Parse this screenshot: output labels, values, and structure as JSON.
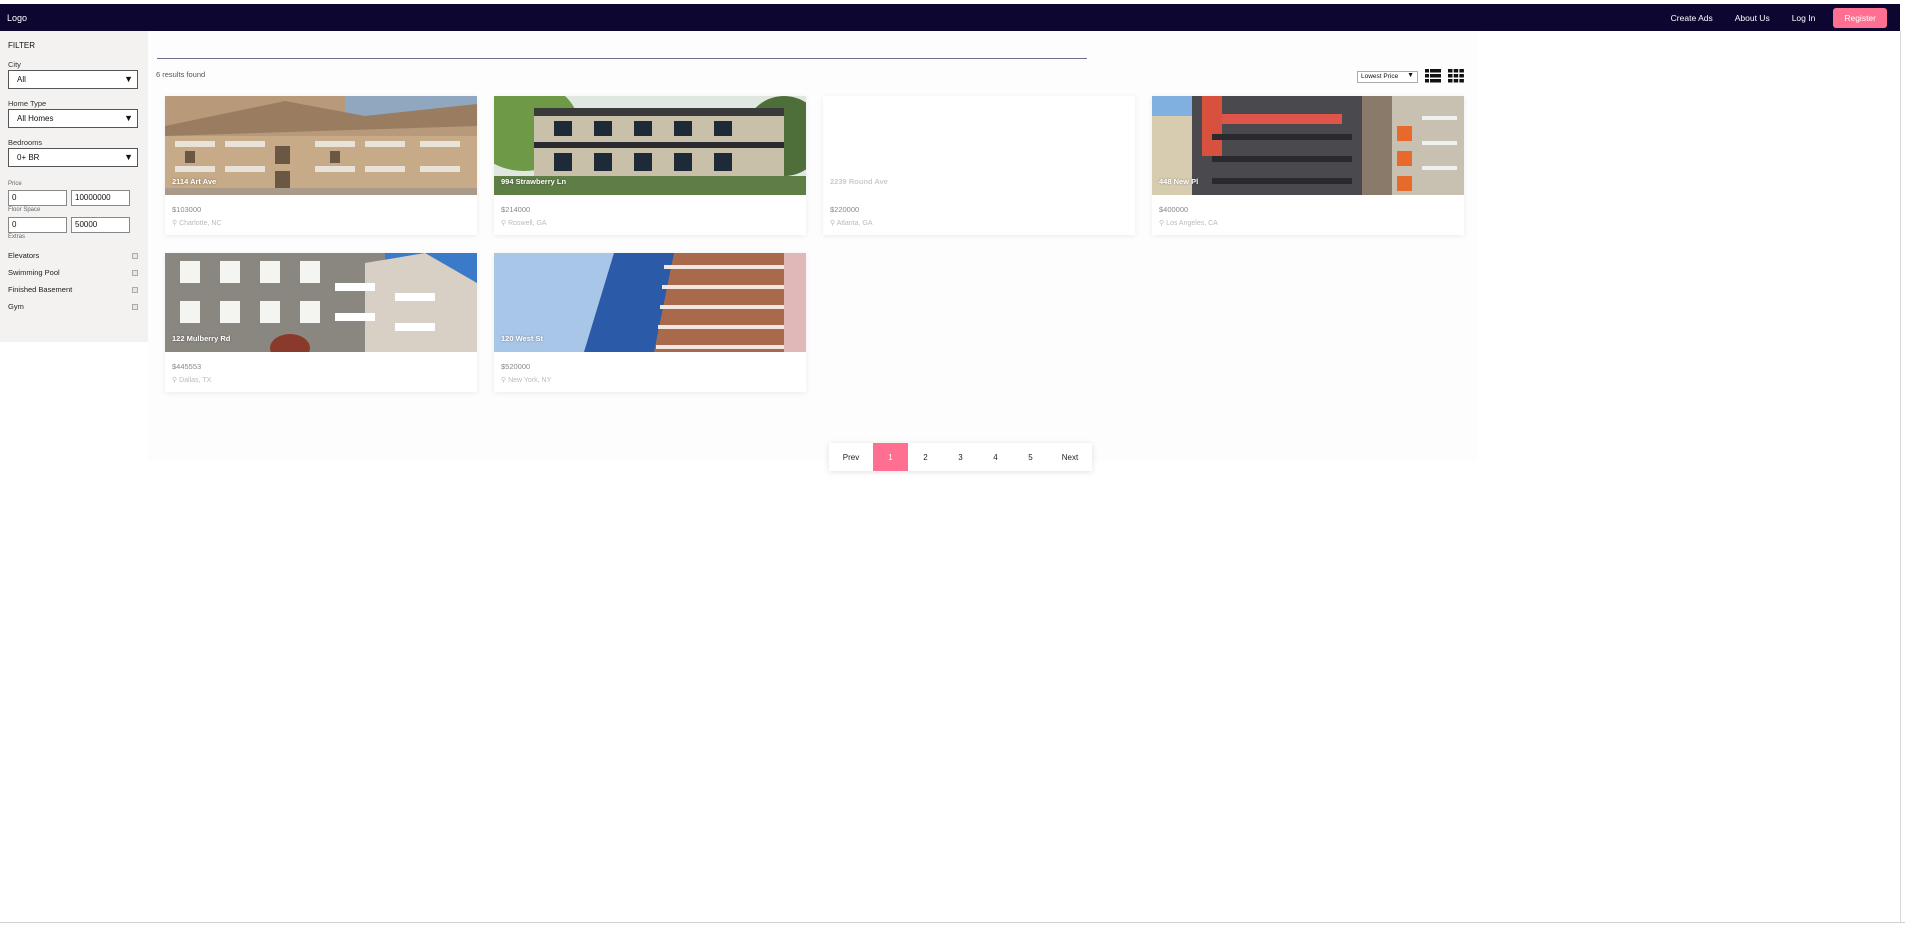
{
  "nav": {
    "logo": "Logo",
    "links": [
      "Create Ads",
      "About Us",
      "Log In"
    ],
    "register": "Register"
  },
  "filter": {
    "title": "FILTER",
    "city_label": "City",
    "city_value": "All",
    "home_type_label": "Home Type",
    "home_type_value": "All Homes",
    "bedrooms_label": "Bedrooms",
    "bedrooms_value": "0+ BR",
    "price_label": "Price",
    "price_min": "0",
    "price_max": "10000000",
    "floor_label": "Floor Space",
    "floor_min": "0",
    "floor_max": "50000",
    "extras_label": "Extras",
    "extras": [
      "Elevators",
      "Swimming Pool",
      "Finished Basement",
      "Gym"
    ]
  },
  "results_text": "6 results found",
  "sort_value": "Lowest Price",
  "listings": [
    {
      "address": "2114 Art Ave",
      "price": "$103000",
      "location": "Charlotte, NC"
    },
    {
      "address": "994 Strawberry Ln",
      "price": "$214000",
      "location": "Roswell, GA"
    },
    {
      "address": "2239 Round Ave",
      "price": "$220000",
      "location": "Atlanta, GA"
    },
    {
      "address": "448 New Pl",
      "price": "$400000",
      "location": "Los Angeles, CA"
    },
    {
      "address": "122 Mulberry Rd",
      "price": "$445553",
      "location": "Dallas, TX"
    },
    {
      "address": "120 West St",
      "price": "$520000",
      "location": "New York, NY"
    }
  ],
  "pagination": {
    "prev": "Prev",
    "pages": [
      "1",
      "2",
      "3",
      "4",
      "5"
    ],
    "next": "Next",
    "current": "1"
  },
  "colors": {
    "navbar": "#0d0630",
    "accent": "#ff6f91"
  }
}
